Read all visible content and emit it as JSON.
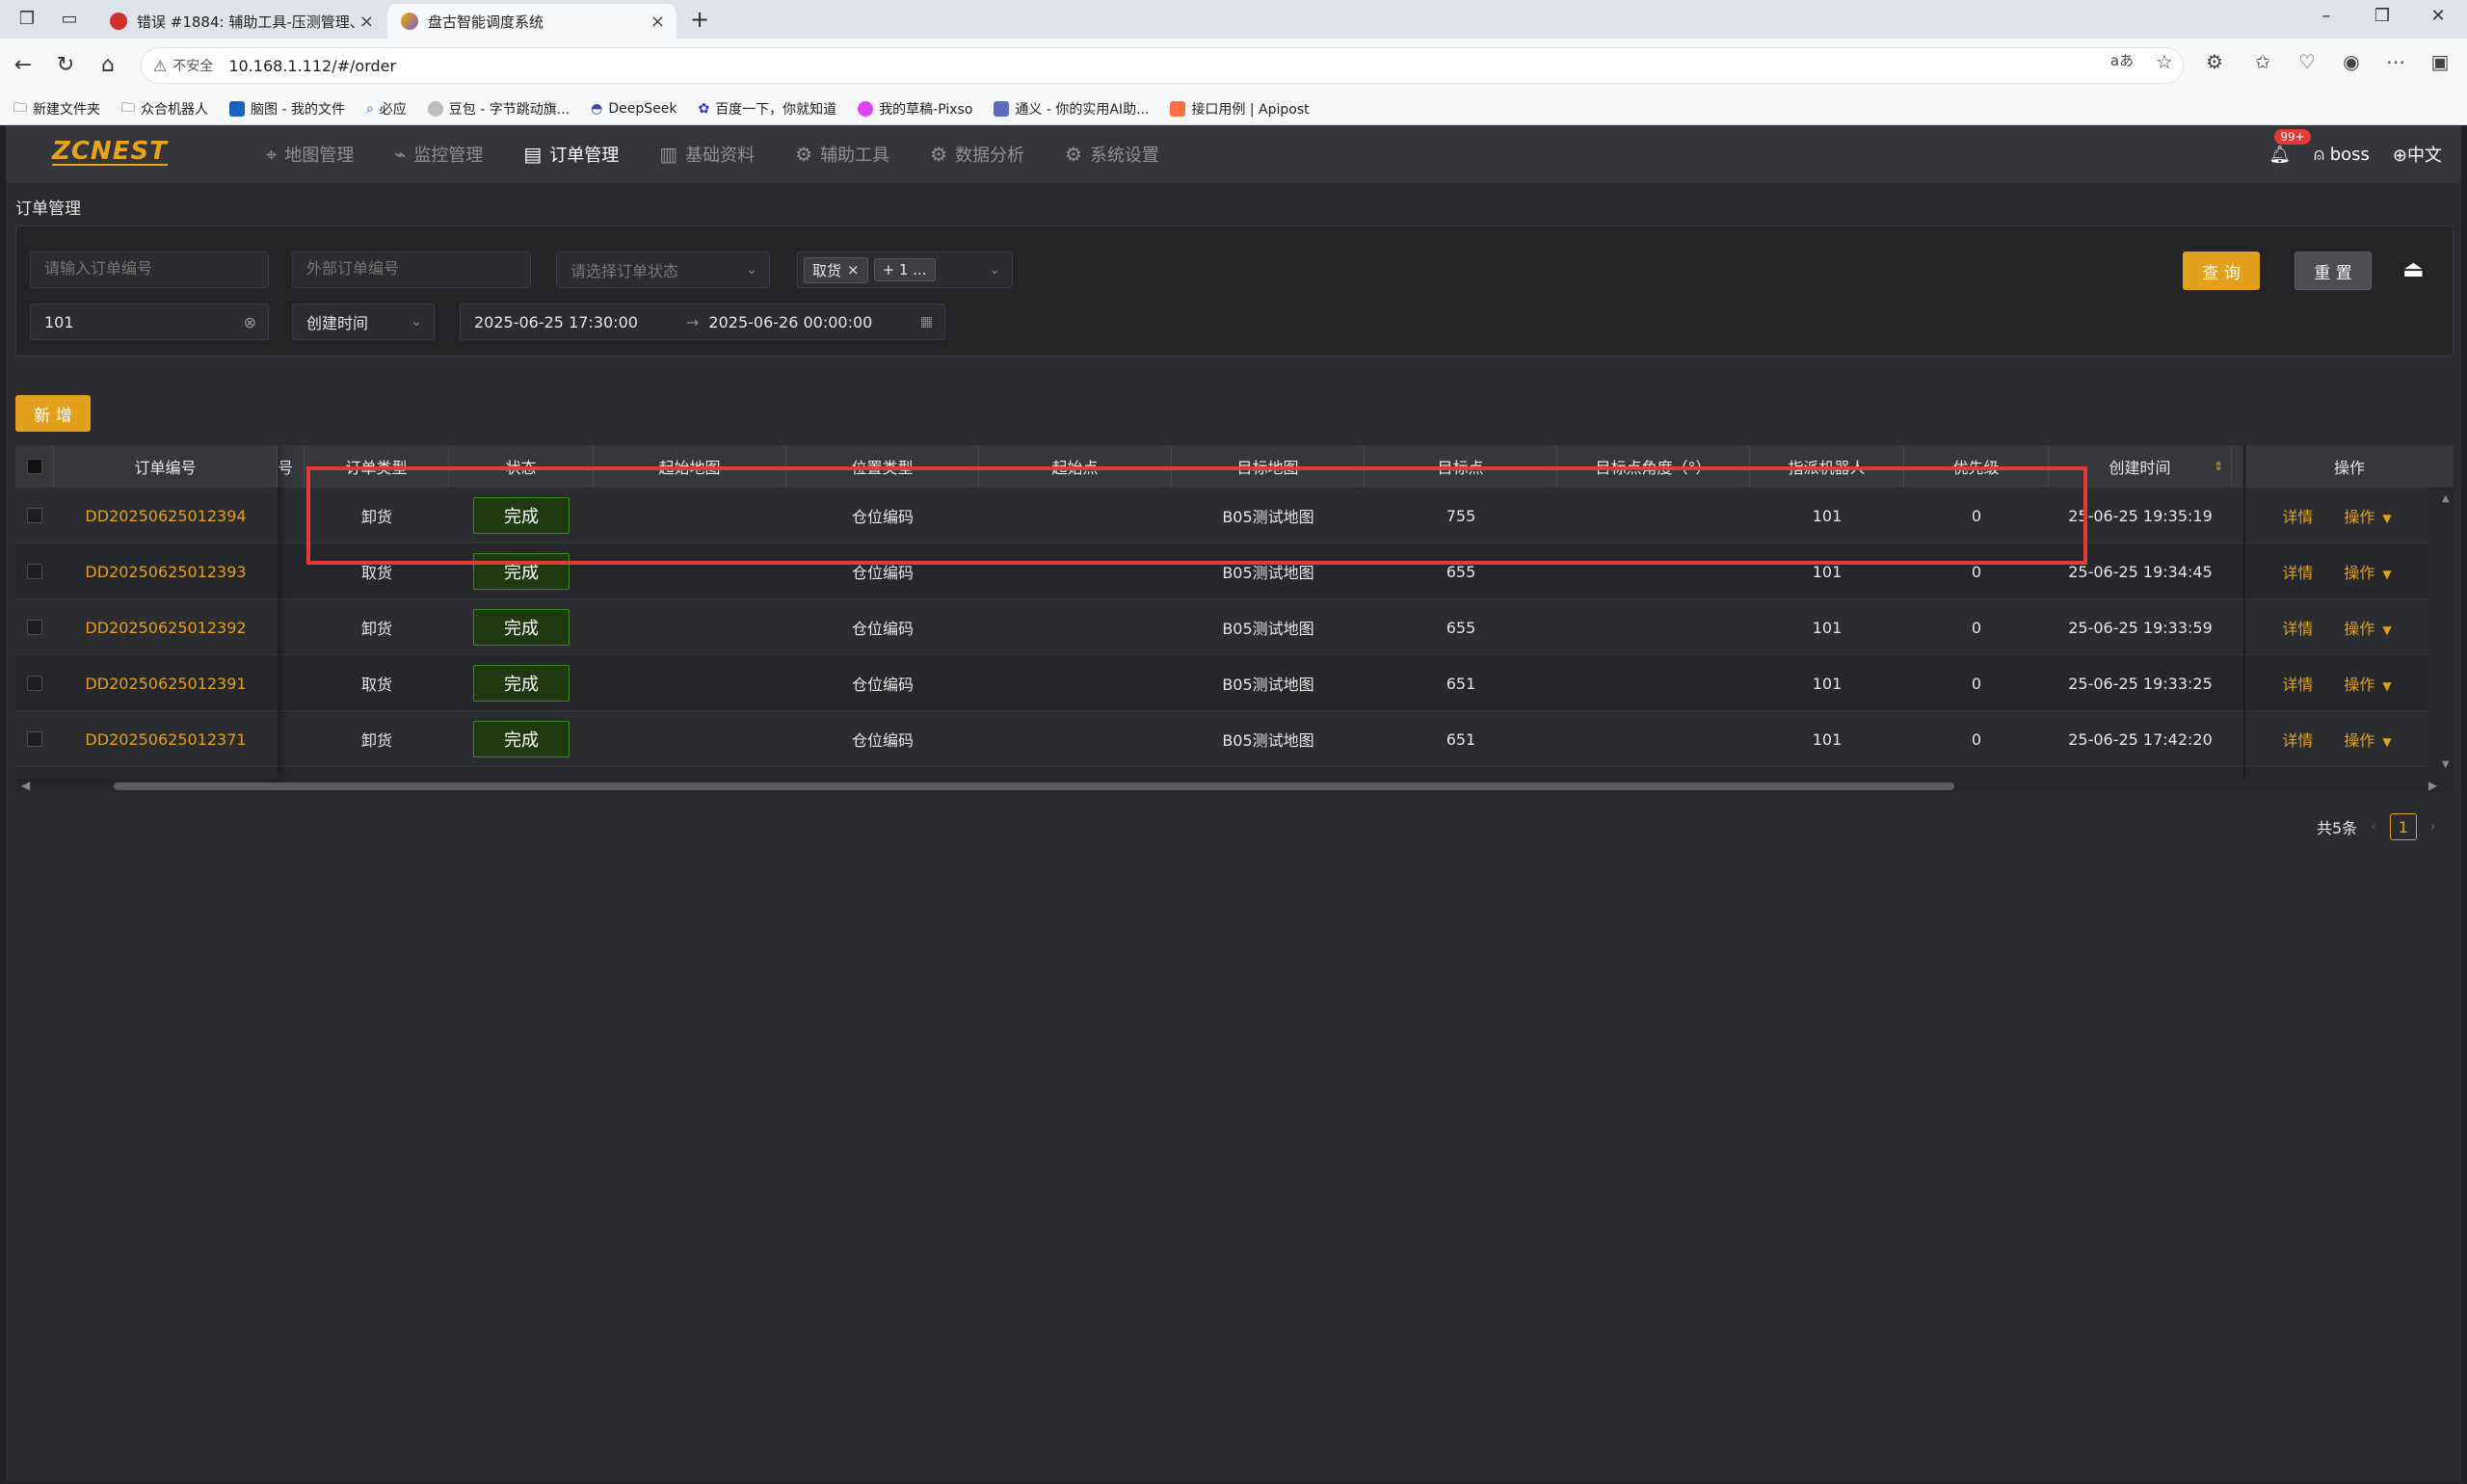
{
  "browser": {
    "tabs": [
      {
        "title": "错误 #1884: 辅助工具-压测管理、",
        "active": false
      },
      {
        "title": "盘古智能调度系统",
        "active": true
      }
    ],
    "url": "10.168.1.112/#/order",
    "insecure_label": "不安全",
    "bookmarks": [
      "新建文件夹",
      "众合机器人",
      "脑图 - 我的文件",
      "必应",
      "豆包 - 字节跳动旗...",
      "DeepSeek",
      "百度一下，你就知道",
      "我的草稿-Pixso",
      "通义 - 你的实用AI助...",
      "接口用例 | Apipost"
    ]
  },
  "app": {
    "logo": "ZCNEST",
    "nav": [
      {
        "label": "地图管理",
        "icon": "map-pin-icon",
        "active": false
      },
      {
        "label": "监控管理",
        "icon": "chart-line-icon",
        "active": false
      },
      {
        "label": "订单管理",
        "icon": "document-icon",
        "active": true
      },
      {
        "label": "基础资料",
        "icon": "data-icon",
        "active": false
      },
      {
        "label": "辅助工具",
        "icon": "gear-icon",
        "active": false
      },
      {
        "label": "数据分析",
        "icon": "gear-icon",
        "active": false
      },
      {
        "label": "系统设置",
        "icon": "gear-icon",
        "active": false
      }
    ],
    "notif_badge": "99+",
    "user": "boss",
    "language": "中文"
  },
  "page": {
    "title": "订单管理",
    "filters": {
      "order_no_placeholder": "请输入订单编号",
      "external_no_placeholder": "外部订单编号",
      "status_placeholder": "请选择订单状态",
      "type_tag": "取货",
      "type_more": "+ 1 ...",
      "robot_value": "101",
      "time_field": "创建时间",
      "date_start": "2025-06-25 17:30:00",
      "date_sep": "→",
      "date_end": "2025-06-26 00:00:00"
    },
    "query_label": "查 询",
    "reset_label": "重 置",
    "add_label": "新 增"
  },
  "table": {
    "headers": {
      "order_no": "订单编号",
      "no_partial": "号",
      "order_type": "订单类型",
      "status": "状态",
      "start_map": "起始地图",
      "position_type": "位置类型",
      "start_point": "起始点",
      "target_map": "目标地图",
      "target_point": "目标点",
      "target_angle": "目标点角度（°）",
      "robot": "指派机器人",
      "priority": "优先级",
      "created": "创建时间",
      "ops": "操作"
    },
    "rows": [
      {
        "order_no": "DD20250625012394",
        "type": "卸货",
        "status": "完成",
        "position_type": "仓位编码",
        "target_map": "B05测试地图",
        "target_point": "755",
        "robot": "101",
        "priority": "0",
        "created": "25-06-25 19:35:19",
        "detail": "详情",
        "op": "操作"
      },
      {
        "order_no": "DD20250625012393",
        "type": "取货",
        "status": "完成",
        "position_type": "仓位编码",
        "target_map": "B05测试地图",
        "target_point": "655",
        "robot": "101",
        "priority": "0",
        "created": "25-06-25 19:34:45",
        "detail": "详情",
        "op": "操作"
      },
      {
        "order_no": "DD20250625012392",
        "type": "卸货",
        "status": "完成",
        "position_type": "仓位编码",
        "target_map": "B05测试地图",
        "target_point": "655",
        "robot": "101",
        "priority": "0",
        "created": "25-06-25 19:33:59",
        "detail": "详情",
        "op": "操作"
      },
      {
        "order_no": "DD20250625012391",
        "type": "取货",
        "status": "完成",
        "position_type": "仓位编码",
        "target_map": "B05测试地图",
        "target_point": "651",
        "robot": "101",
        "priority": "0",
        "created": "25-06-25 19:33:25",
        "detail": "详情",
        "op": "操作"
      },
      {
        "order_no": "DD20250625012371",
        "type": "卸货",
        "status": "完成",
        "position_type": "仓位编码",
        "target_map": "B05测试地图",
        "target_point": "651",
        "robot": "101",
        "priority": "0",
        "created": "25-06-25 17:42:20",
        "detail": "详情",
        "op": "操作"
      }
    ]
  },
  "pagination": {
    "total": "共5条",
    "current": "1"
  },
  "colors": {
    "accent": "#e2a01d",
    "status_green": "#3c8a1e",
    "highlight_red": "#e53935"
  }
}
